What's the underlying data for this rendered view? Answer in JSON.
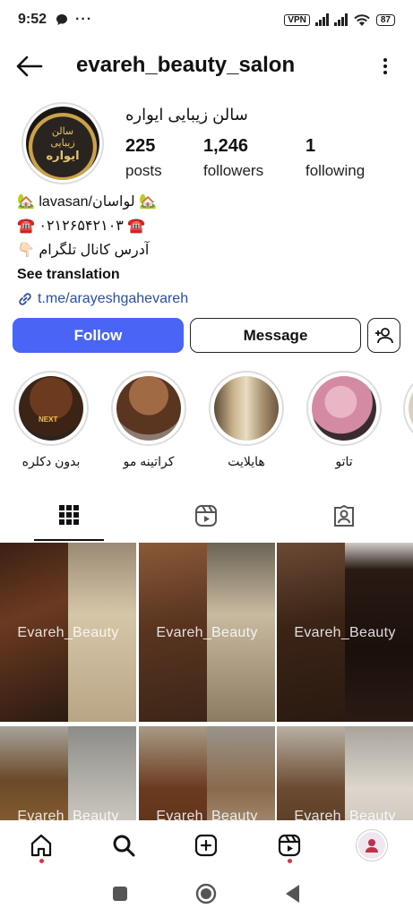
{
  "status_bar": {
    "time": "9:52",
    "vpn": "VPN",
    "battery": "87"
  },
  "header": {
    "username": "evareh_beauty_salon"
  },
  "profile": {
    "avatar_text": [
      "سالن",
      "زیبایی",
      "ایواره"
    ],
    "full_name": "سالن زیبایی ایواره",
    "stats": [
      {
        "value": "225",
        "label": "posts"
      },
      {
        "value": "1,246",
        "label": "followers"
      },
      {
        "value": "1",
        "label": "following"
      }
    ],
    "bio": {
      "line1": "🏡 lavasan/لواسان 🏡",
      "line2": "☎️ ۰۲۱۲۶۵۴۲۱۰۳ ☎️",
      "line3": "👇🏻 آدرس کانال تلگرام",
      "see_translation": "See translation",
      "link": "t.me/arayeshgahevareh"
    }
  },
  "actions": {
    "follow": "Follow",
    "message": "Message"
  },
  "highlights": [
    {
      "label": "بدون دکلره",
      "overlay": "NEXT"
    },
    {
      "label": "کراتینه مو"
    },
    {
      "label": "هایلایت"
    },
    {
      "label": "تاتو"
    }
  ],
  "grid": {
    "watermark": "Evareh_Beauty"
  },
  "colors": {
    "accent": "#4a65f5",
    "link": "#2a4ea8",
    "notification": "#e0304a"
  }
}
